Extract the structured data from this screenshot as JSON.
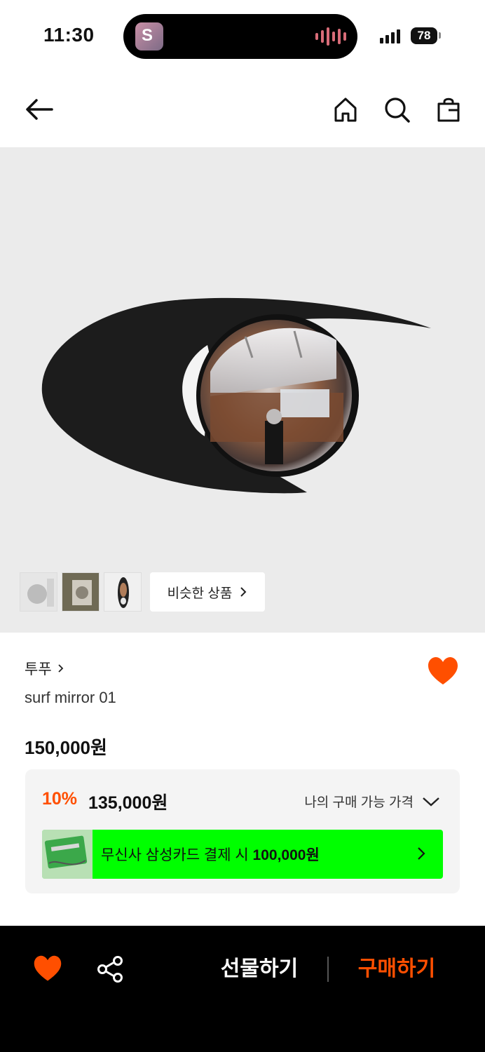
{
  "status_bar": {
    "time": "11:30",
    "battery": "78"
  },
  "nav": {
    "back_icon": "arrow-left-icon",
    "home_icon": "home-icon",
    "search_icon": "search-icon",
    "cart_icon": "shopping-bag-icon"
  },
  "gallery": {
    "similar_label": "비슷한 상품"
  },
  "product": {
    "brand": "투푸",
    "name": "surf mirror 01",
    "price": "150,000원",
    "liked": true
  },
  "discount": {
    "rate": "10%",
    "price": "135,000원",
    "my_price_label": "나의 구매 가능 가격"
  },
  "card_offer": {
    "text_prefix": "무신사 삼성카드 결제 시",
    "amount": "100,000원",
    "banner_color": "#00ff00"
  },
  "bottom_bar": {
    "gift_label": "선물하기",
    "buy_label": "구매하기",
    "accent_color": "#ff4f00"
  }
}
